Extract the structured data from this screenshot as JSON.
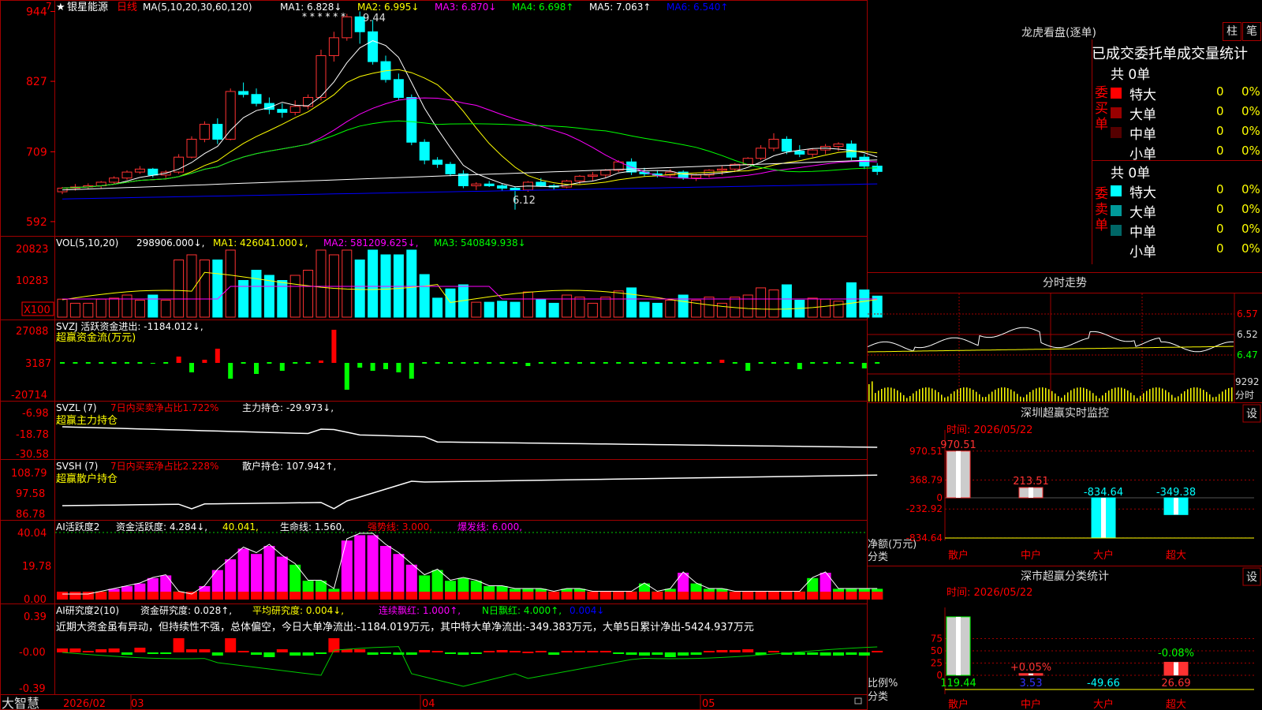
{
  "header": {
    "star": "★",
    "stock_name": "银星能源",
    "period": "日线",
    "ma_def": "MA(5,10,20,30,60,120)",
    "ma": [
      {
        "label": "MA1:",
        "value": "6.828↓",
        "color": "#ffffff"
      },
      {
        "label": "MA2:",
        "value": "6.995↓",
        "color": "#ffff00"
      },
      {
        "label": "MA3:",
        "value": "6.870↓",
        "color": "#ff00ff"
      },
      {
        "label": "MA4:",
        "value": "6.698↑",
        "color": "#00ff00"
      },
      {
        "label": "MA5:",
        "value": "7.063↑",
        "color": "#ffffff"
      },
      {
        "label": "MA6:",
        "value": "6.540↑",
        "color": "#0000ff"
      }
    ]
  },
  "price_panel": {
    "ticks": [
      "944",
      "827",
      "709",
      "592"
    ],
    "high_label": "9.44",
    "low_label": "6.12",
    "marker": "7"
  },
  "vol_panel": {
    "title": "VOL(5,10,20)",
    "value": "298906.000↓,",
    "ma1": "MA1: 426041.000↓,",
    "ma2": "MA2: 581209.625↓,",
    "ma3": "MA3: 540849.938↓",
    "ticks": [
      "20823",
      "10283"
    ],
    "unit": "X100"
  },
  "svzj_panel": {
    "title": "SVZJ  活跃资金进出: -1184.012↓,",
    "subtitle": "超赢资金流(万元)",
    "ticks": [
      "27088",
      "3187",
      "-20714"
    ]
  },
  "svzl_panel": {
    "title": "SVZL (7)",
    "ratio": "7日内买卖净占比1.722%",
    "hold": "主力持仓: -29.973↓,",
    "subtitle": "超赢主力持仓",
    "ticks": [
      "-6.98",
      "-18.78",
      "-30.58"
    ]
  },
  "svsh_panel": {
    "title": "SVSH (7)",
    "ratio": "7日内买卖净占比2.228%",
    "hold": "散户持仓: 107.942↑,",
    "subtitle": "超赢散户持仓",
    "ticks": [
      "108.79",
      "97.58",
      "86.78"
    ]
  },
  "ai_active_panel": {
    "title": "AI活跃度2",
    "degree": "资金活跃度: 4.284↓,",
    "val2": "40.041,",
    "life": "生命线: 1.560,",
    "strong": "强势线: 3.000,",
    "burst": "爆发线: 6.000,",
    "ticks": [
      "40.04",
      "19.78",
      "0.00"
    ]
  },
  "ai_research_panel": {
    "title": "AI研究度2(10)",
    "research": "资金研究度: 0.028↑,",
    "avg": "平均研究度: 0.004↓,",
    "lianxu": "连续飘红: 1.000↑,",
    "nday": "N日飘红: 4.000↑,",
    "last": "0.004↓",
    "comment": "近期大资金虽有异动，但持续性不强，总体偏空，今日大单净流出:-1184.019万元，其中特大单净流出:-349.383万元，大单5日累计净出-5424.937万元",
    "ticks": [
      "0.39",
      "-0.00",
      "-0.39"
    ]
  },
  "bottom_bar": {
    "brand": "大智慧",
    "dates": [
      "2026/02",
      "03",
      "04",
      "05"
    ]
  },
  "right_top": {
    "title": "龙虎看盘(逐单)",
    "btn_zhu": "柱",
    "btn_bi": "笔",
    "table_title": "已成交委托单成交量统计",
    "buy_label": "委买单",
    "sell_label": "委卖单",
    "buy_total": "共 0单",
    "sell_total": "共 0单",
    "buy_rows": [
      {
        "name": "特大",
        "count": "0",
        "pct": "0%",
        "color": "#ff0000"
      },
      {
        "name": "大单",
        "count": "0",
        "pct": "0%",
        "color": "#990000"
      },
      {
        "name": "中单",
        "count": "0",
        "pct": "0%",
        "color": "#550000"
      },
      {
        "name": "小单",
        "count": "0",
        "pct": "0%",
        "color": ""
      }
    ],
    "sell_rows": [
      {
        "name": "特大",
        "count": "0",
        "pct": "0%",
        "color": "#00ffff"
      },
      {
        "name": "大单",
        "count": "0",
        "pct": "0%",
        "color": "#009999"
      },
      {
        "name": "中单",
        "count": "0",
        "pct": "0%",
        "color": "#006666"
      },
      {
        "name": "小单",
        "count": "0",
        "pct": "0%",
        "color": ""
      }
    ]
  },
  "intraday": {
    "title": "分时走势",
    "ticks": [
      "6.57",
      "6.52",
      "6.47"
    ],
    "vol_tick": "9292",
    "vol_label": "分时"
  },
  "sz_monitor": {
    "title": "深圳超赢实时监控",
    "set_btn": "设",
    "time_label": "时间: 2026/05/22",
    "ticks": [
      "970.51",
      "368.79",
      "0",
      "-232.92",
      "-834.64"
    ],
    "y_unit": "净额(万元)",
    "cat_label": "分类",
    "categories": [
      "散户",
      "中户",
      "大户",
      "超大"
    ],
    "values": [
      970.51,
      213.51,
      -834.64,
      -349.38
    ],
    "labels": [
      "970.51",
      "213.51",
      "-834.64",
      "-349.38"
    ]
  },
  "sz_class": {
    "title": "深市超赢分类统计",
    "set_btn": "设",
    "time_label": "时间: 2026/05/22",
    "ticks": [
      "75",
      "50",
      "25",
      "0"
    ],
    "y_unit": "比例%",
    "cat_label": "分类",
    "categories": [
      "散户",
      "中户",
      "大户",
      "超大"
    ],
    "values": [
      119.44,
      3.53,
      -49.66,
      26.69
    ],
    "value_labels": [
      "119.44",
      "3.53",
      "-49.66",
      "26.69"
    ],
    "pct_labels": [
      "",
      "+0.05%",
      "",
      "-0.08%"
    ]
  },
  "chart_data": {
    "type": "candlestick",
    "candles": [
      [
        6.42,
        6.5,
        6.38,
        6.48
      ],
      [
        6.48,
        6.55,
        6.44,
        6.5
      ],
      [
        6.5,
        6.56,
        6.46,
        6.52
      ],
      [
        6.52,
        6.6,
        6.48,
        6.58
      ],
      [
        6.58,
        6.68,
        6.55,
        6.65
      ],
      [
        6.65,
        6.78,
        6.62,
        6.75
      ],
      [
        6.75,
        6.85,
        6.72,
        6.8
      ],
      [
        6.8,
        6.82,
        6.66,
        6.7
      ],
      [
        6.7,
        6.78,
        6.65,
        6.75
      ],
      [
        6.75,
        7.05,
        6.72,
        7.0
      ],
      [
        7.0,
        7.35,
        6.98,
        7.3
      ],
      [
        7.3,
        7.6,
        7.25,
        7.55
      ],
      [
        7.55,
        7.65,
        7.22,
        7.3
      ],
      [
        7.3,
        8.15,
        7.28,
        8.1
      ],
      [
        8.1,
        8.25,
        8.0,
        8.05
      ],
      [
        8.05,
        8.15,
        7.85,
        7.9
      ],
      [
        7.9,
        8.0,
        7.72,
        7.8
      ],
      [
        7.8,
        7.9,
        7.66,
        7.75
      ],
      [
        7.75,
        7.95,
        7.7,
        7.85
      ],
      [
        7.85,
        8.05,
        7.8,
        8.0
      ],
      [
        8.0,
        8.8,
        7.95,
        8.7
      ],
      [
        8.7,
        9.1,
        8.6,
        9.0
      ],
      [
        9.0,
        9.4,
        8.95,
        9.35
      ],
      [
        9.35,
        9.44,
        8.9,
        9.1
      ],
      [
        9.1,
        9.3,
        8.55,
        8.6
      ],
      [
        8.6,
        8.7,
        8.25,
        8.3
      ],
      [
        8.3,
        8.4,
        7.95,
        8.0
      ],
      [
        8.0,
        8.05,
        7.2,
        7.25
      ],
      [
        7.25,
        7.3,
        6.88,
        6.95
      ],
      [
        6.95,
        7.0,
        6.82,
        6.88
      ],
      [
        6.88,
        6.92,
        6.68,
        6.72
      ],
      [
        6.72,
        6.78,
        6.48,
        6.52
      ],
      [
        6.52,
        6.58,
        6.45,
        6.55
      ],
      [
        6.55,
        6.6,
        6.5,
        6.52
      ],
      [
        6.52,
        6.55,
        6.44,
        6.48
      ],
      [
        6.48,
        6.5,
        6.12,
        6.45
      ],
      [
        6.45,
        6.6,
        6.42,
        6.58
      ],
      [
        6.58,
        6.65,
        6.5,
        6.52
      ],
      [
        6.52,
        6.55,
        6.46,
        6.5
      ],
      [
        6.5,
        6.62,
        6.48,
        6.6
      ],
      [
        6.6,
        6.7,
        6.55,
        6.68
      ],
      [
        6.68,
        6.75,
        6.6,
        6.7
      ],
      [
        6.7,
        6.8,
        6.65,
        6.78
      ],
      [
        6.78,
        6.95,
        6.75,
        6.92
      ],
      [
        6.92,
        6.98,
        6.7,
        6.75
      ],
      [
        6.75,
        6.82,
        6.68,
        6.72
      ],
      [
        6.72,
        6.78,
        6.66,
        6.7
      ],
      [
        6.7,
        6.8,
        6.65,
        6.75
      ],
      [
        6.75,
        6.78,
        6.62,
        6.65
      ],
      [
        6.65,
        6.72,
        6.6,
        6.7
      ],
      [
        6.7,
        6.8,
        6.66,
        6.78
      ],
      [
        6.78,
        6.85,
        6.7,
        6.8
      ],
      [
        6.8,
        6.9,
        6.75,
        6.88
      ],
      [
        6.88,
        7.0,
        6.85,
        6.98
      ],
      [
        6.98,
        7.2,
        6.95,
        7.15
      ],
      [
        7.15,
        7.4,
        7.1,
        7.3
      ],
      [
        7.3,
        7.35,
        7.05,
        7.1
      ],
      [
        7.1,
        7.2,
        7.0,
        7.05
      ],
      [
        7.05,
        7.15,
        7.0,
        7.12
      ],
      [
        7.12,
        7.22,
        7.05,
        7.18
      ],
      [
        7.18,
        7.25,
        7.1,
        7.22
      ],
      [
        7.22,
        7.28,
        6.95,
        7.0
      ],
      [
        7.0,
        7.05,
        6.8,
        6.85
      ],
      [
        6.85,
        6.9,
        6.7,
        6.76
      ]
    ]
  }
}
